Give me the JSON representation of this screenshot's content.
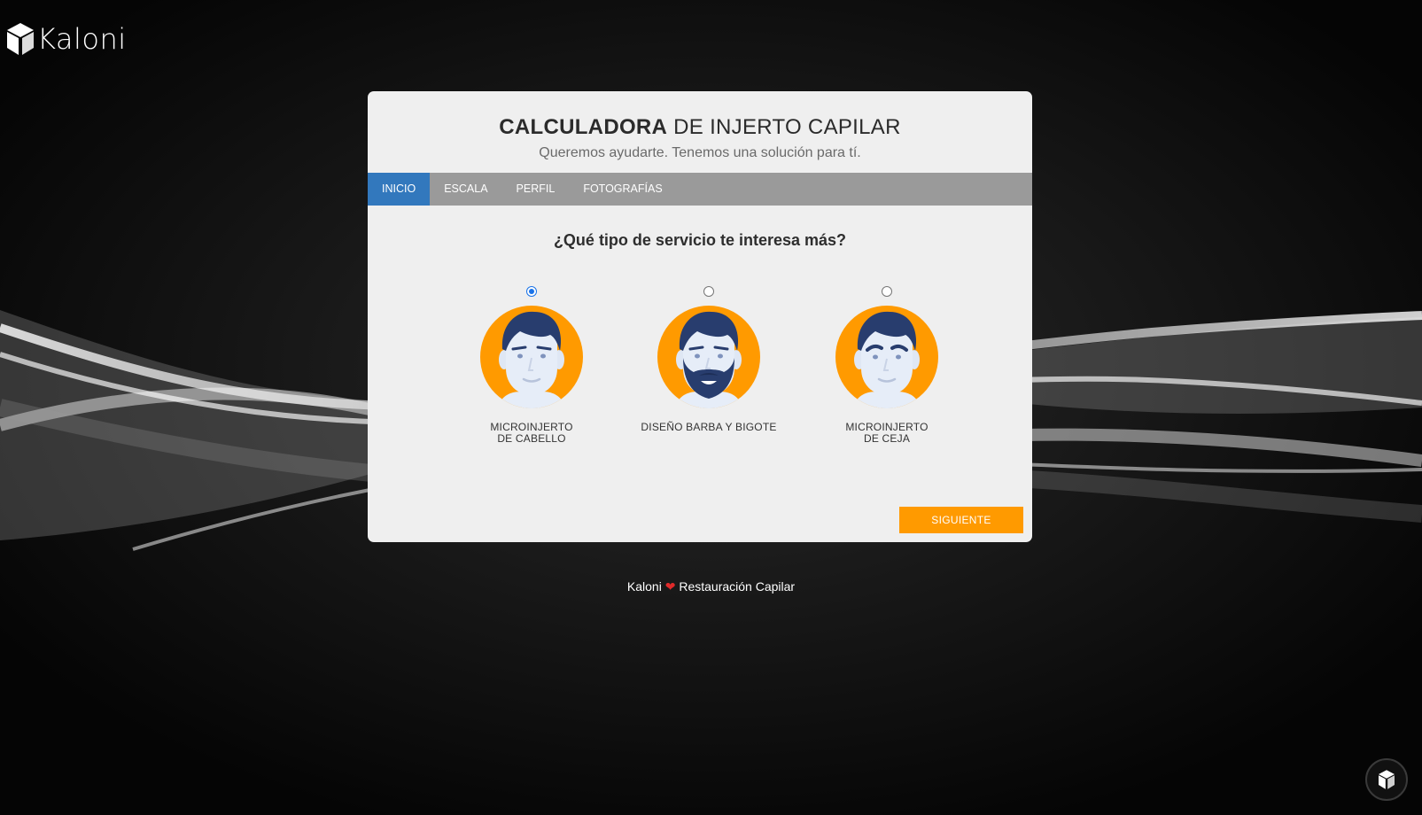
{
  "brand": {
    "name": "Kaloni"
  },
  "card": {
    "title_bold": "CALCULADORA",
    "title_rest": " DE INJERTO CAPILAR",
    "subtitle": "Queremos ayudarte. Tenemos una solución para tí."
  },
  "tabs": [
    {
      "label": "INICIO",
      "active": true
    },
    {
      "label": "ESCALA",
      "active": false
    },
    {
      "label": "PERFIL",
      "active": false
    },
    {
      "label": "FOTOGRAFÍAS",
      "active": false
    }
  ],
  "question": "¿Qué tipo de servicio te interesa más?",
  "options": [
    {
      "line1": "MICROINJERTO",
      "line2": "DE CABELLO",
      "selected": true,
      "icon": "man-avatar-icon"
    },
    {
      "line1": "DISEÑO BARBA Y BIGOTE",
      "line2": "",
      "selected": false,
      "icon": "bearded-man-avatar-icon"
    },
    {
      "line1": "MICROINJERTO",
      "line2": "DE CEJA",
      "selected": false,
      "icon": "man-eyebrow-avatar-icon"
    }
  ],
  "next_button": "SIGUIENTE",
  "footer": {
    "left": "Kaloni",
    "right": "Restauración Capilar",
    "heart": "❤"
  },
  "colors": {
    "accent_orange": "#ff9a00",
    "tab_active": "#3278bd",
    "tab_bar": "#9a9a9a",
    "hair_navy": "#283d6e",
    "skin": "#e6edf8"
  }
}
